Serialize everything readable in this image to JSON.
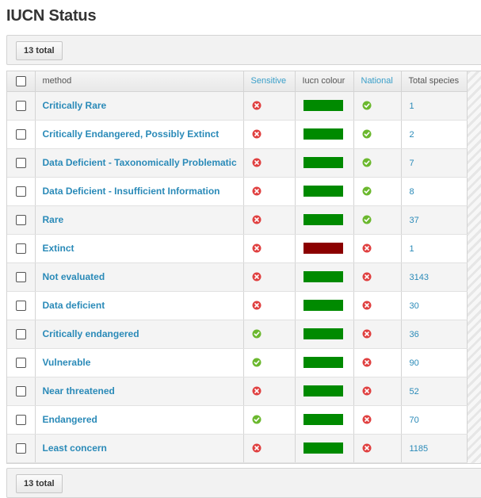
{
  "page": {
    "title": "IUCN Status"
  },
  "toolbar": {
    "total_label": "13 total"
  },
  "columns": {
    "method": "method",
    "sensitive": "Sensitive",
    "colour": "Iucn colour",
    "national": "National",
    "total": "Total species"
  },
  "colors": {
    "green": "#008a00",
    "darkred": "#8b0000",
    "yes": "#6bb82e",
    "no": "#e04040"
  },
  "rows": [
    {
      "method": "Critically Rare",
      "sensitive": false,
      "colour": "#008a00",
      "national": true,
      "total": "1"
    },
    {
      "method": "Critically Endangered, Possibly Extinct",
      "sensitive": false,
      "colour": "#008a00",
      "national": true,
      "total": "2"
    },
    {
      "method": "Data Deficient - Taxonomically Problematic",
      "sensitive": false,
      "colour": "#008a00",
      "national": true,
      "total": "7"
    },
    {
      "method": "Data Deficient - Insufficient Information",
      "sensitive": false,
      "colour": "#008a00",
      "national": true,
      "total": "8"
    },
    {
      "method": "Rare",
      "sensitive": false,
      "colour": "#008a00",
      "national": true,
      "total": "37"
    },
    {
      "method": "Extinct",
      "sensitive": false,
      "colour": "#8b0000",
      "national": false,
      "total": "1"
    },
    {
      "method": "Not evaluated",
      "sensitive": false,
      "colour": "#008a00",
      "national": false,
      "total": "3143"
    },
    {
      "method": "Data deficient",
      "sensitive": false,
      "colour": "#008a00",
      "national": false,
      "total": "30"
    },
    {
      "method": "Critically endangered",
      "sensitive": true,
      "colour": "#008a00",
      "national": false,
      "total": "36"
    },
    {
      "method": "Vulnerable",
      "sensitive": true,
      "colour": "#008a00",
      "national": false,
      "total": "90"
    },
    {
      "method": "Near threatened",
      "sensitive": false,
      "colour": "#008a00",
      "national": false,
      "total": "52"
    },
    {
      "method": "Endangered",
      "sensitive": true,
      "colour": "#008a00",
      "national": false,
      "total": "70"
    },
    {
      "method": "Least concern",
      "sensitive": false,
      "colour": "#008a00",
      "national": false,
      "total": "1185"
    }
  ]
}
